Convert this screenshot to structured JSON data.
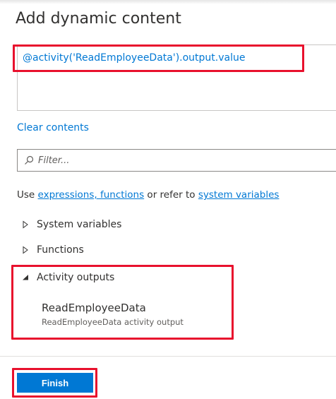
{
  "dialog": {
    "title": "Add dynamic content"
  },
  "expression": {
    "value": "@activity('ReadEmployeeData').output.value"
  },
  "clear_contents_label": "Clear contents",
  "filter": {
    "placeholder": "Filter..."
  },
  "hint": {
    "prefix": "Use ",
    "link_expressions": "expressions, functions",
    "middle": " or refer to ",
    "link_system": "system variables"
  },
  "sections": [
    {
      "label": "System variables",
      "expanded": false
    },
    {
      "label": "Functions",
      "expanded": false
    },
    {
      "label": "Activity outputs",
      "expanded": true
    }
  ],
  "activity_outputs": [
    {
      "name": "ReadEmployeeData",
      "description": "ReadEmployeeData activity output"
    }
  ],
  "footer": {
    "finish_label": "Finish"
  },
  "colors": {
    "accent": "#0078d4",
    "highlight": "#e8112d"
  },
  "icons": {
    "filter": "search-icon",
    "collapsed": "triangle-right-icon",
    "expanded": "triangle-down-icon"
  }
}
